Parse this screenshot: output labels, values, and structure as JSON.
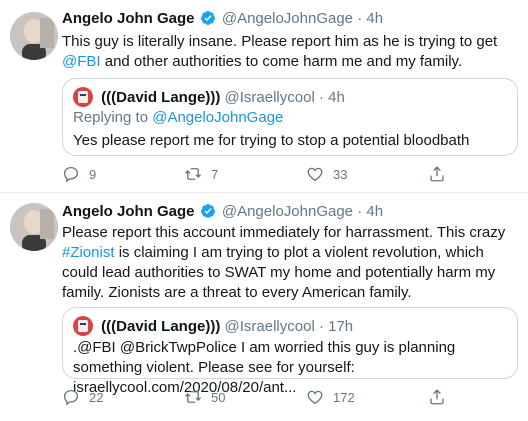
{
  "colors": {
    "link": "#1b95e0",
    "muted": "#657786",
    "verified": "#1da1f2",
    "border": "#ccd6dd"
  },
  "tweets": [
    {
      "author": "Angelo John Gage",
      "handle": "@AngeloJohnGage",
      "sep": "·",
      "time": "4h",
      "text_parts": [
        "This guy is literally insane. Please report him as he is trying to get ",
        "@FBI",
        " and other authorities to come harm me and my family."
      ],
      "quote": {
        "author": "(((David Lange)))",
        "handle": "@Israellycool",
        "sep": "·",
        "time": "4h",
        "reply_prefix": "Replying to ",
        "reply_to": "@AngeloJohnGage",
        "text": "Yes please report me for trying to stop a potential bloodbath"
      },
      "actions": {
        "replies": "9",
        "retweets": "7",
        "likes": "33"
      }
    },
    {
      "author": "Angelo John Gage",
      "handle": "@AngeloJohnGage",
      "sep": "·",
      "time": "4h",
      "text_parts": [
        "Please report this account immediately for harrassment. This crazy ",
        "#Zionist",
        " is claiming I am trying to plot a violent revolution, which could lead authorities to SWAT my home and potentially harm my family. Zionists are a threat to every American family."
      ],
      "quote": {
        "author": "(((David Lange)))",
        "handle": "@Israellycool",
        "sep": "·",
        "time": "17h",
        "text": ".@FBI @BrickTwpPolice I am worried this guy is planning something violent. Please see for yourself: israellycool.com/2020/08/20/ant..."
      },
      "actions": {
        "replies": "22",
        "retweets": "50",
        "likes": "172"
      }
    }
  ]
}
